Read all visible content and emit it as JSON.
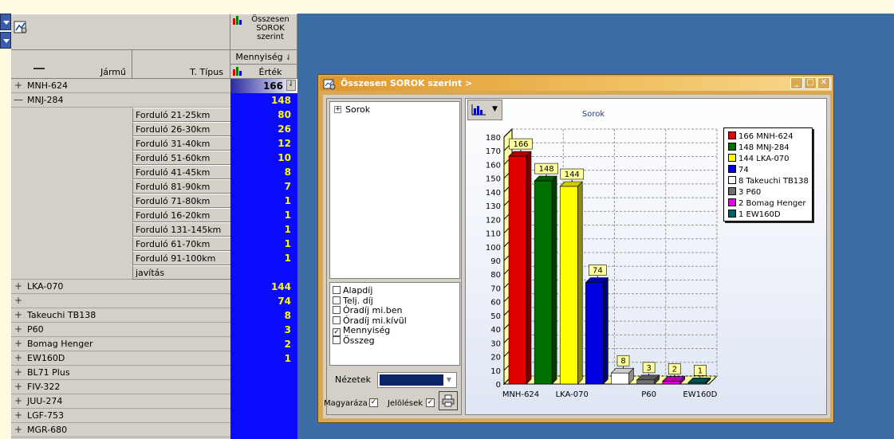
{
  "pivot": {
    "header_title": "Összesen SOROK szerint",
    "measure_label": "Mennyiség",
    "value_label": "Érték",
    "col_jarmu": "Jármű",
    "col_tipus": "T. Típus"
  },
  "rows": [
    {
      "exp": "+",
      "label": "MNH-624",
      "value": "166",
      "selected": true
    },
    {
      "exp": "—",
      "label": "MNJ-284",
      "value": "148"
    },
    {
      "exp": "+",
      "label": "LKA-070",
      "value": "144"
    },
    {
      "exp": "+",
      "label": "",
      "value": "74"
    },
    {
      "exp": "+",
      "label": "Takeuchi TB138",
      "value": "8"
    },
    {
      "exp": "+",
      "label": "P60",
      "value": "3"
    },
    {
      "exp": "+",
      "label": "Bomag Henger",
      "value": "2"
    },
    {
      "exp": "+",
      "label": "EW160D",
      "value": "1"
    },
    {
      "exp": "+",
      "label": "BL71 Plus",
      "value": ""
    },
    {
      "exp": "+",
      "label": "FIV-322",
      "value": ""
    },
    {
      "exp": "+",
      "label": "JUU-274",
      "value": ""
    },
    {
      "exp": "+",
      "label": "LGF-753",
      "value": ""
    },
    {
      "exp": "+",
      "label": "MGR-680",
      "value": ""
    }
  ],
  "subrows": [
    {
      "label": "Forduló 21-25km",
      "value": "80"
    },
    {
      "label": "Forduló 26-30km",
      "value": "26"
    },
    {
      "label": "Forduló 31-40km",
      "value": "12"
    },
    {
      "label": "Forduló 51-60km",
      "value": "10"
    },
    {
      "label": "Forduló 41-45km",
      "value": "8"
    },
    {
      "label": "Forduló 81-90km",
      "value": "7"
    },
    {
      "label": "Forduló 71-80km",
      "value": "1"
    },
    {
      "label": "Forduló 16-20km",
      "value": "1"
    },
    {
      "label": "Forduló 131-145km",
      "value": "1"
    },
    {
      "label": "Forduló 61-70km",
      "value": "1"
    },
    {
      "label": "Forduló 91-100km",
      "value": "1"
    },
    {
      "label": "javítás",
      "value": ""
    }
  ],
  "window": {
    "title": "Összesen SOROK szerint >",
    "tree_root": "Sorok",
    "views_label": "Nézetek",
    "explain_label": "Magyaráza",
    "marks_label": "Jelölések"
  },
  "checks": [
    {
      "label": "Alapdíj",
      "checked": false
    },
    {
      "label": "Telj. díj",
      "checked": false
    },
    {
      "label": "Óradíj mi.ben",
      "checked": false
    },
    {
      "label": "Óradíj mi.kívül",
      "checked": false
    },
    {
      "label": "Mennyiség",
      "checked": true
    },
    {
      "label": "Összeg",
      "checked": false
    }
  ],
  "chart_data": {
    "type": "bar",
    "title": "Sorok",
    "categories": [
      "MNH-624",
      "MNJ-284",
      "LKA-070",
      "",
      "Takeuchi TB138",
      "P60",
      "Bomag Henger",
      "EW160D"
    ],
    "axis_tick_labels": [
      "MNH-624",
      "LKA-070",
      "P60",
      "EW160D"
    ],
    "values": [
      166,
      148,
      144,
      74,
      8,
      3,
      2,
      1
    ],
    "colors": [
      "#e00000",
      "#007000",
      "#ffff00",
      "#0000e0",
      "#ffffff",
      "#707070",
      "#e000e0",
      "#006060"
    ],
    "legend": [
      "166 MNH-624",
      "148 MNJ-284",
      "144 LKA-070",
      "74",
      "8 Takeuchi TB138",
      "3 P60",
      "2 Bomag Henger",
      "1 EW160D"
    ],
    "ylim": [
      0,
      180
    ],
    "yticks": [
      0,
      10,
      20,
      30,
      40,
      50,
      60,
      70,
      80,
      90,
      100,
      110,
      120,
      130,
      140,
      150,
      160,
      170,
      180
    ],
    "grid": true,
    "legend_position": "right"
  }
}
